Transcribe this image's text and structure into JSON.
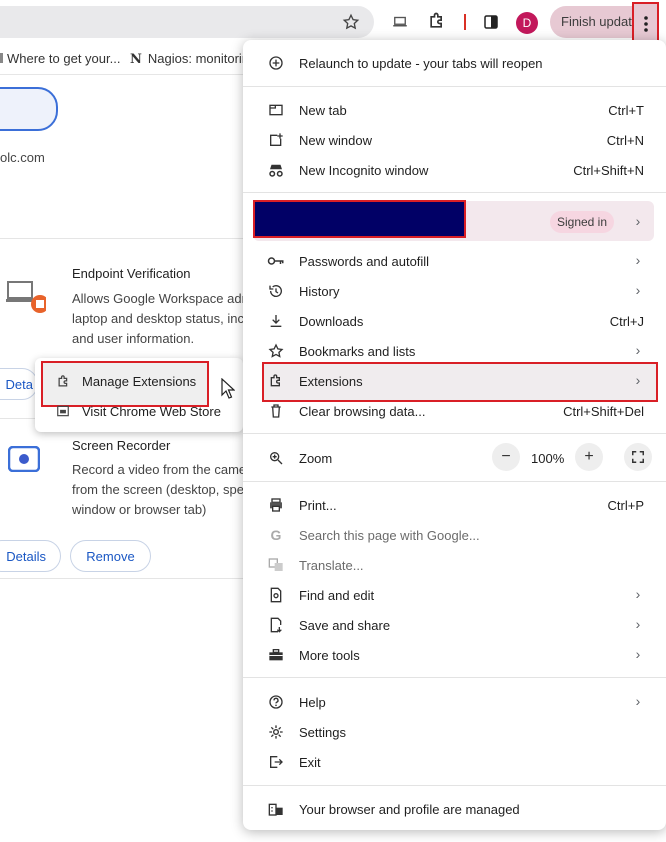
{
  "toolbar": {
    "avatar_letter": "D",
    "finish_update": "Finish update"
  },
  "bookmarks": [
    {
      "label": "Where to get your..."
    },
    {
      "label": "Nagios: monitorin"
    }
  ],
  "page": {
    "domain_fragment": "olc.com",
    "endpoint": {
      "title": "Endpoint Verification",
      "desc_lines": [
        "Allows Google Workspace adr",
        "laptop and desktop status, inc",
        "and user information."
      ],
      "details_label": "Deta"
    },
    "recorder": {
      "title": "Screen Recorder",
      "desc_lines": [
        "Record a video from the came",
        "from the screen (desktop, spe",
        "window or browser tab)"
      ],
      "details_label": "Details",
      "remove_label": "Remove"
    }
  },
  "context_menu": {
    "items": [
      {
        "label": "Manage Extensions"
      },
      {
        "label": "Visit Chrome Web Store"
      }
    ]
  },
  "menu": {
    "relaunch": "Relaunch to update - your tabs will reopen",
    "new_tab": {
      "label": "New tab",
      "shortcut": "Ctrl+T"
    },
    "new_window": {
      "label": "New window",
      "shortcut": "Ctrl+N"
    },
    "incognito": {
      "label": "New Incognito window",
      "shortcut": "Ctrl+Shift+N"
    },
    "signed_in": "Signed in",
    "passwords": "Passwords and autofill",
    "history": "History",
    "downloads": {
      "label": "Downloads",
      "shortcut": "Ctrl+J"
    },
    "bookmarks": "Bookmarks and lists",
    "extensions": "Extensions",
    "clear": {
      "label": "Clear browsing data...",
      "shortcut": "Ctrl+Shift+Del"
    },
    "zoom": {
      "label": "Zoom",
      "minus": "−",
      "value": "100%",
      "plus": "+"
    },
    "print": {
      "label": "Print...",
      "shortcut": "Ctrl+P"
    },
    "search_google": "Search this page with Google...",
    "translate": "Translate...",
    "find_edit": "Find and edit",
    "save_share": "Save and share",
    "more_tools": "More tools",
    "help": "Help",
    "settings": "Settings",
    "exit": "Exit",
    "managed": "Your browser and profile are managed"
  },
  "colors": {
    "highlight_border": "#d91f26",
    "redaction": "#010066",
    "accent_link": "#1a57c4"
  }
}
